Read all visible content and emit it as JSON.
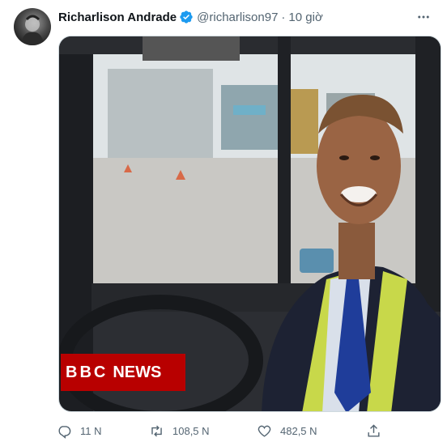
{
  "tweet": {
    "author_name": "Richarlison Andrade",
    "handle": "@richarlison97",
    "separator": "·",
    "time": "10 giờ",
    "more_icon": "more-horizontal-icon",
    "verified_icon": "verified-badge-icon",
    "verified_color": "#1d9bf0"
  },
  "media": {
    "watermark_bbc": "BBC",
    "watermark_news": "NEWS",
    "watermark_color": "#b80000"
  },
  "actions": {
    "reply_count": "11 N",
    "retweet_count": "108,5 N",
    "like_count": "482,5 N",
    "reply_icon": "reply-icon",
    "retweet_icon": "retweet-icon",
    "like_icon": "like-icon",
    "share_icon": "share-icon"
  }
}
